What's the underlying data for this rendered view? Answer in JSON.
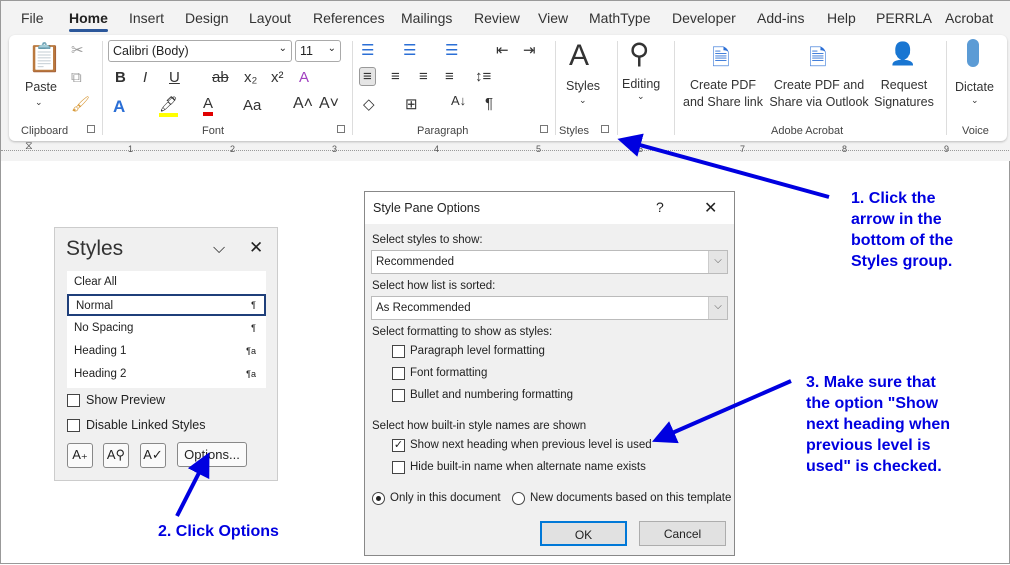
{
  "tabs": [
    "File",
    "Home",
    "Insert",
    "Design",
    "Layout",
    "References",
    "Mailings",
    "Review",
    "View",
    "MathType",
    "Developer",
    "Add-ins",
    "Help",
    "PERRLA",
    "Acrobat"
  ],
  "ribbon": {
    "clipboard": {
      "paste": "Paste",
      "label": "Clipboard"
    },
    "font": {
      "name": "Calibri (Body)",
      "size": "11",
      "label": "Font"
    },
    "paragraph": {
      "label": "Paragraph"
    },
    "styles": {
      "button": "Styles",
      "label": "Styles"
    },
    "editing": {
      "button": "Editing"
    },
    "acrobat": {
      "create_share_1": "Create PDF",
      "create_share_2": "and Share link",
      "create_outlook_1": "Create PDF and",
      "create_outlook_2": "Share via Outlook",
      "request_1": "Request",
      "request_2": "Signatures",
      "label": "Adobe Acrobat"
    },
    "voice": {
      "dictate": "Dictate",
      "label": "Voice"
    }
  },
  "ruler": [
    "1",
    "2",
    "3",
    "4",
    "5",
    "6",
    "7",
    "8",
    "9"
  ],
  "styles_pane": {
    "title": "Styles",
    "items": [
      {
        "name": "Clear All",
        "mark": ""
      },
      {
        "name": "Normal",
        "mark": "¶"
      },
      {
        "name": "No Spacing",
        "mark": "¶"
      },
      {
        "name": "Heading 1",
        "mark": "¶a"
      },
      {
        "name": "Heading 2",
        "mark": "¶a"
      }
    ],
    "show_preview": "Show Preview",
    "disable_linked": "Disable Linked Styles",
    "options": "Options..."
  },
  "dialog": {
    "title": "Style Pane Options",
    "help": "?",
    "select_label": "Select styles to show:",
    "select_value": "Recommended",
    "sort_label": "Select how list is sorted:",
    "sort_value": "As Recommended",
    "format_label": "Select formatting to show as styles:",
    "format_options": [
      "Paragraph level formatting",
      "Font formatting",
      "Bullet and numbering formatting"
    ],
    "names_label": "Select how built-in style names are shown",
    "show_next": "Show next heading when previous level is used",
    "hide_builtin": "Hide built-in name when alternate name exists",
    "radio_doc": "Only in this document",
    "radio_template": "New documents based on this template",
    "ok": "OK",
    "cancel": "Cancel"
  },
  "annotations": {
    "step1": [
      "1. Click the",
      "arrow in the",
      "bottom of the",
      "Styles group."
    ],
    "step2": "2. Click Options",
    "step3": [
      "3. Make sure that",
      "the option \"Show",
      "next heading when",
      "previous level is",
      "used\" is checked."
    ]
  },
  "colors": {
    "annotation": "#0000e0",
    "accent": "#2b579a"
  }
}
